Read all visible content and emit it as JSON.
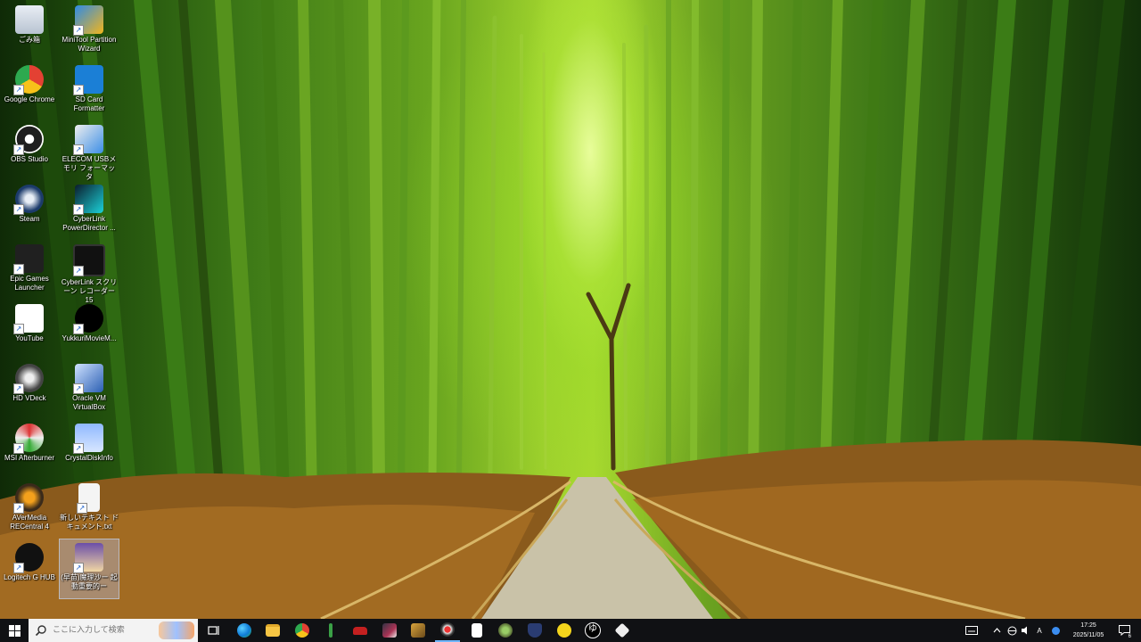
{
  "desktop": {
    "icons": [
      {
        "label": "ごみ箱",
        "icon": "recycle-bin-icon"
      },
      {
        "label": "MiniTool Partition Wizard",
        "icon": "minitool-icon"
      },
      {
        "label": "Google Chrome",
        "icon": "chrome-icon"
      },
      {
        "label": "SD Card Formatter",
        "icon": "sd-card-icon"
      },
      {
        "label": "OBS Studio",
        "icon": "obs-icon"
      },
      {
        "label": "ELECOM USBメモリ フォーマッタ",
        "icon": "elecom-icon"
      },
      {
        "label": "Steam",
        "icon": "steam-icon"
      },
      {
        "label": "CyberLink PowerDirector ...",
        "icon": "powerdirector-icon"
      },
      {
        "label": "Epic Games Launcher",
        "icon": "epic-games-icon"
      },
      {
        "label": "CyberLink スクリーン レコーダー 15",
        "icon": "screen-recorder-icon"
      },
      {
        "label": "YouTube",
        "icon": "youtube-icon"
      },
      {
        "label": "YukkuriMovieM...",
        "icon": "ymm-icon"
      },
      {
        "label": "HD VDeck",
        "icon": "hd-vdeck-icon"
      },
      {
        "label": "Oracle VM VirtualBox",
        "icon": "virtualbox-icon"
      },
      {
        "label": "MSI Afterburner",
        "icon": "msi-afterburner-icon"
      },
      {
        "label": "CrystalDiskInfo",
        "icon": "crystaldiskinfo-icon"
      },
      {
        "label": "AVerMedia RECentral 4",
        "icon": "recentral-icon"
      },
      {
        "label": "新しいテキスト ドキュメント.txt",
        "icon": "text-document-icon"
      },
      {
        "label": "Logitech G HUB",
        "icon": "logitech-icon"
      },
      {
        "label": "(早苗)魔理沙ー 起動重要的ー",
        "icon": "character-file-icon"
      }
    ]
  },
  "taskbar": {
    "search_placeholder": "ここに入力して検索",
    "apps": [
      "task-view",
      "edge",
      "file-explorer",
      "chrome",
      "pin-app",
      "car-app",
      "obs-like-app",
      "photo-app",
      "record-app",
      "usb-app",
      "figure-app",
      "shield-app",
      "smile-app",
      "yukkuri-app",
      "cube-app"
    ],
    "tray": {
      "ime": "A",
      "time": "17:25",
      "date": "2025/11/05",
      "notifications": "6"
    }
  },
  "colors": {
    "taskbar": "#101114",
    "search_bg": "#f3f3f3",
    "accent": "#1a5fc9"
  }
}
